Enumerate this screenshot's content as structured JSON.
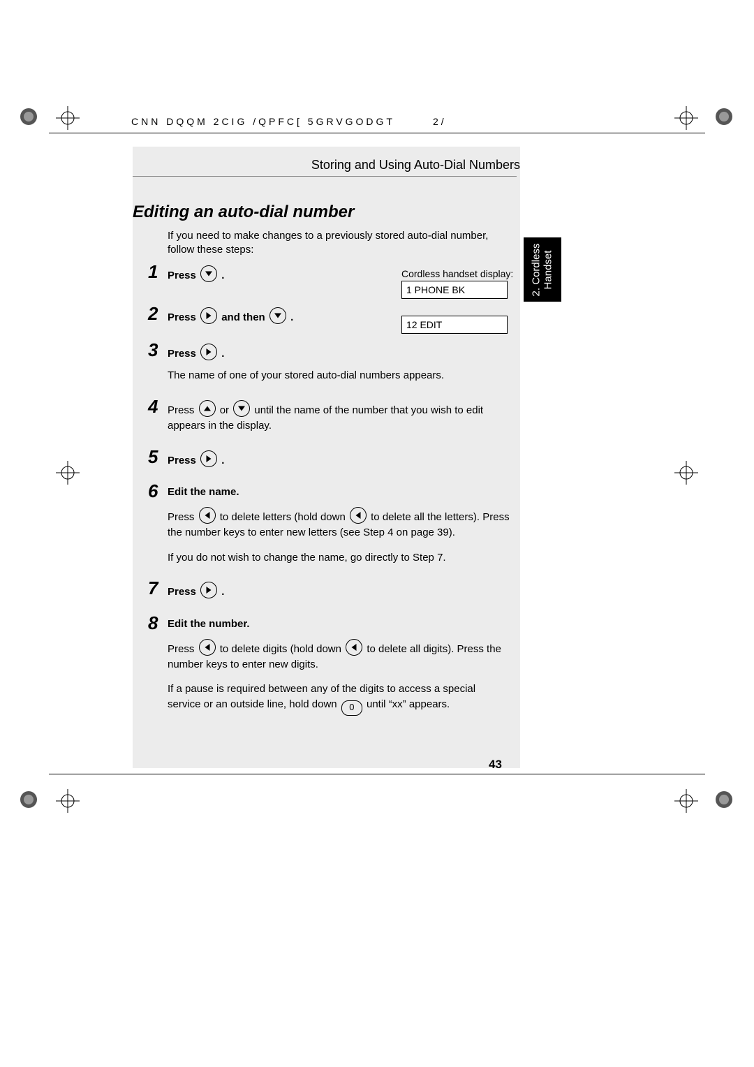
{
  "header": {
    "code": "CNN DQQM 2CIG  /QPFC[ 5GRVGODGT",
    "code_page": "2/"
  },
  "region_title": "Storing and Using Auto-Dial Numbers",
  "heading": "Editing an auto-dial number",
  "intro": "If you need to make changes to a previously stored auto-dial number, follow these steps:",
  "display": {
    "label": "Cordless handset display:",
    "box1": "1  PHONE BK",
    "box2": "12 EDIT"
  },
  "steps": {
    "s1": {
      "num": "1",
      "press": "Press ",
      "dot": "."
    },
    "s2": {
      "num": "2",
      "press": "Press ",
      "and_then": " and then ",
      "dot": "."
    },
    "s3": {
      "num": "3",
      "press": "Press ",
      "dot": ".",
      "sub": "The name of one of your stored auto-dial numbers appears."
    },
    "s4": {
      "num": "4",
      "press": "Press ",
      "or": " or ",
      "rest": " until the name of the number that you wish to edit appears in the display."
    },
    "s5": {
      "num": "5",
      "press": "Press ",
      "dot": "."
    },
    "s6": {
      "num": "6",
      "title": "Edit the name.",
      "sub_a1": "Press ",
      "sub_a2": " to delete letters (hold down ",
      "sub_a3": " to delete all the letters). Press the number keys to enter new letters (see Step 4 on page 39).",
      "sub_b": "If you do not wish to change the name, go directly to Step 7."
    },
    "s7": {
      "num": "7",
      "press": "Press ",
      "dot": "."
    },
    "s8": {
      "num": "8",
      "title": "Edit the number.",
      "sub_a1": "Press ",
      "sub_a2": " to delete digits (hold down ",
      "sub_a3": " to delete all digits). Press the number keys to enter new digits.",
      "sub_b1": "If a pause is required between any of the digits to access a special service or an outside line, hold down ",
      "sub_b2": " until “xx” appears."
    }
  },
  "tab": {
    "line1": "2. Cordless",
    "line2": "Handset"
  },
  "page_number": "43",
  "zero_key": "0"
}
